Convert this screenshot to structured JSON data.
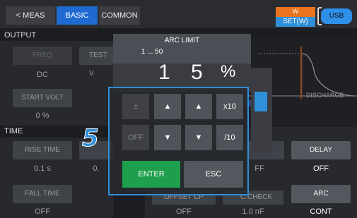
{
  "topbar": {
    "meas_tab": "< MEAS",
    "basic_tab": "BASIC",
    "common_tab": "COMMON",
    "w_label": "W",
    "set_label": "SET(W)",
    "usb_label": "USB"
  },
  "output": {
    "section": "OUTPUT",
    "freq_label": "FREQ",
    "freq_value": "DC",
    "test_label": "TEST V",
    "start_volt_label": "START VOLT",
    "start_volt_value": "0 %"
  },
  "time": {
    "section": "TIME",
    "rise_label": "RISE TIME",
    "rise_value": "0.1 s",
    "rise_partial": "0.",
    "fall_label": "FALL TIME",
    "fall_value": "OFF"
  },
  "right": {
    "discharge_label": "DISCHARGE",
    "delay_label": "DELAY",
    "delay_value": "OFF",
    "delay_partial": "FF",
    "offset_label": "OFFSET CP",
    "offset_value": "OFF",
    "ccheck_label": "C.CHECK",
    "ccheck_value": "1.0 nF",
    "arc_label": "ARC",
    "arc_value": "CONT"
  },
  "dialog": {
    "title": "ARC LIMIT",
    "range": "1 ... 50",
    "digits": [
      "1",
      "5"
    ],
    "unit": "%"
  },
  "keypad": {
    "plusminus": "±",
    "up": "▲",
    "x10": "x10",
    "off": "OFF",
    "down": "▼",
    "div10": "/10",
    "enter": "ENTER",
    "esc": "ESC"
  },
  "step_number": "5",
  "colors": {
    "accent_blue": "#1f6ad1",
    "highlight_blue": "#2f8fd8",
    "enter_green": "#1e9f4c",
    "wset_orange": "#e9731f"
  }
}
